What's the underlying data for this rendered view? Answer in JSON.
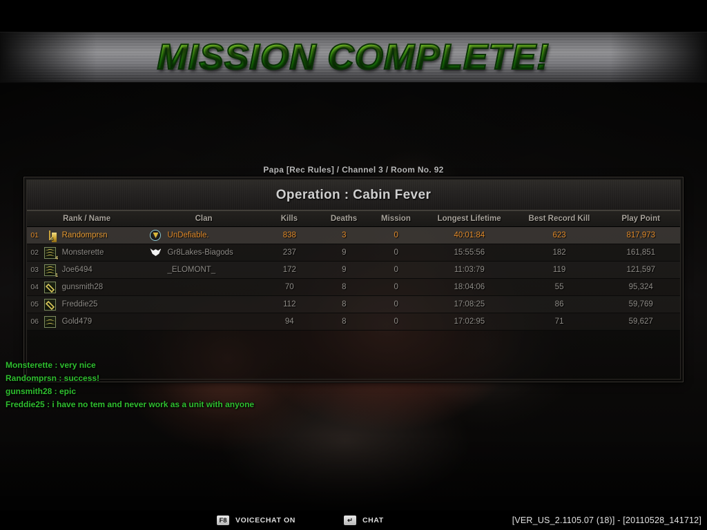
{
  "banner": {
    "text": "MISSION COMPLETE!",
    "color": "#4aa818"
  },
  "room": {
    "line": "Papa [Rec Rules] / Channel 3  / Room No. 92"
  },
  "panel": {
    "title": "Operation : Cabin Fever",
    "columns": {
      "rank_name": "Rank / Name",
      "clan": "Clan",
      "kills": "Kills",
      "deaths": "Deaths",
      "mission": "Mission",
      "longest_lifetime": "Longest Lifetime",
      "best_record_kill": "Best Record Kill",
      "play_point": "Play Point"
    },
    "rows": [
      {
        "rank": "01",
        "name": "Randomprsn",
        "clan": "UnDefiable.",
        "kills": "838",
        "deaths": "3",
        "mission": "0",
        "longest_lifetime": "40:01:84",
        "best_record_kill": "623",
        "play_point": "817,973",
        "badge": "gold-bar-icon",
        "badge_sub": "4",
        "clan_emblem": "shield-emblem-icon",
        "highlight": true
      },
      {
        "rank": "02",
        "name": "Monsterette",
        "clan": "Gr8Lakes-Biagods",
        "kills": "237",
        "deaths": "9",
        "mission": "0",
        "longest_lifetime": "15:55:56",
        "best_record_kill": "182",
        "play_point": "161,851",
        "badge": "chevron-stack-icon",
        "badge_sub": "4",
        "clan_emblem": "wings-emblem-icon",
        "highlight": false
      },
      {
        "rank": "03",
        "name": "Joe6494",
        "clan": "_ELOMONT_",
        "kills": "172",
        "deaths": "9",
        "mission": "0",
        "longest_lifetime": "11:03:79",
        "best_record_kill": "119",
        "play_point": "121,597",
        "badge": "chevron-stack-icon",
        "badge_sub": "1",
        "clan_emblem": "none",
        "highlight": false
      },
      {
        "rank": "04",
        "name": "gunsmith28",
        "clan": "",
        "kills": "70",
        "deaths": "8",
        "mission": "0",
        "longest_lifetime": "18:04:06",
        "best_record_kill": "55",
        "play_point": "95,324",
        "badge": "diamond-icon",
        "badge_sub": "",
        "clan_emblem": "none",
        "highlight": false
      },
      {
        "rank": "05",
        "name": "Freddie25",
        "clan": "",
        "kills": "112",
        "deaths": "8",
        "mission": "0",
        "longest_lifetime": "17:08:25",
        "best_record_kill": "86",
        "play_point": "59,769",
        "badge": "diamond-icon",
        "badge_sub": "",
        "clan_emblem": "none",
        "highlight": false
      },
      {
        "rank": "06",
        "name": "Gold479",
        "clan": "",
        "kills": "94",
        "deaths": "8",
        "mission": "0",
        "longest_lifetime": "17:02:95",
        "best_record_kill": "71",
        "play_point": "59,627",
        "badge": "double-chevron-icon",
        "badge_sub": "",
        "clan_emblem": "none",
        "highlight": false
      }
    ]
  },
  "chat": {
    "color": "#2fbf2f",
    "lines": [
      "Monsterette : very nice",
      "Randomprsn : success!",
      "gunsmith28 : epic",
      "Freddie25 :  i have no tem and never work as a unit with anyone"
    ]
  },
  "hud": {
    "voicechat_key": "F8",
    "voicechat_label": "VOICECHAT ON",
    "chat_key": "↵",
    "chat_label": "CHAT",
    "version": "[VER_US_2.1105.07 (18)] - [20110528_141712]"
  }
}
